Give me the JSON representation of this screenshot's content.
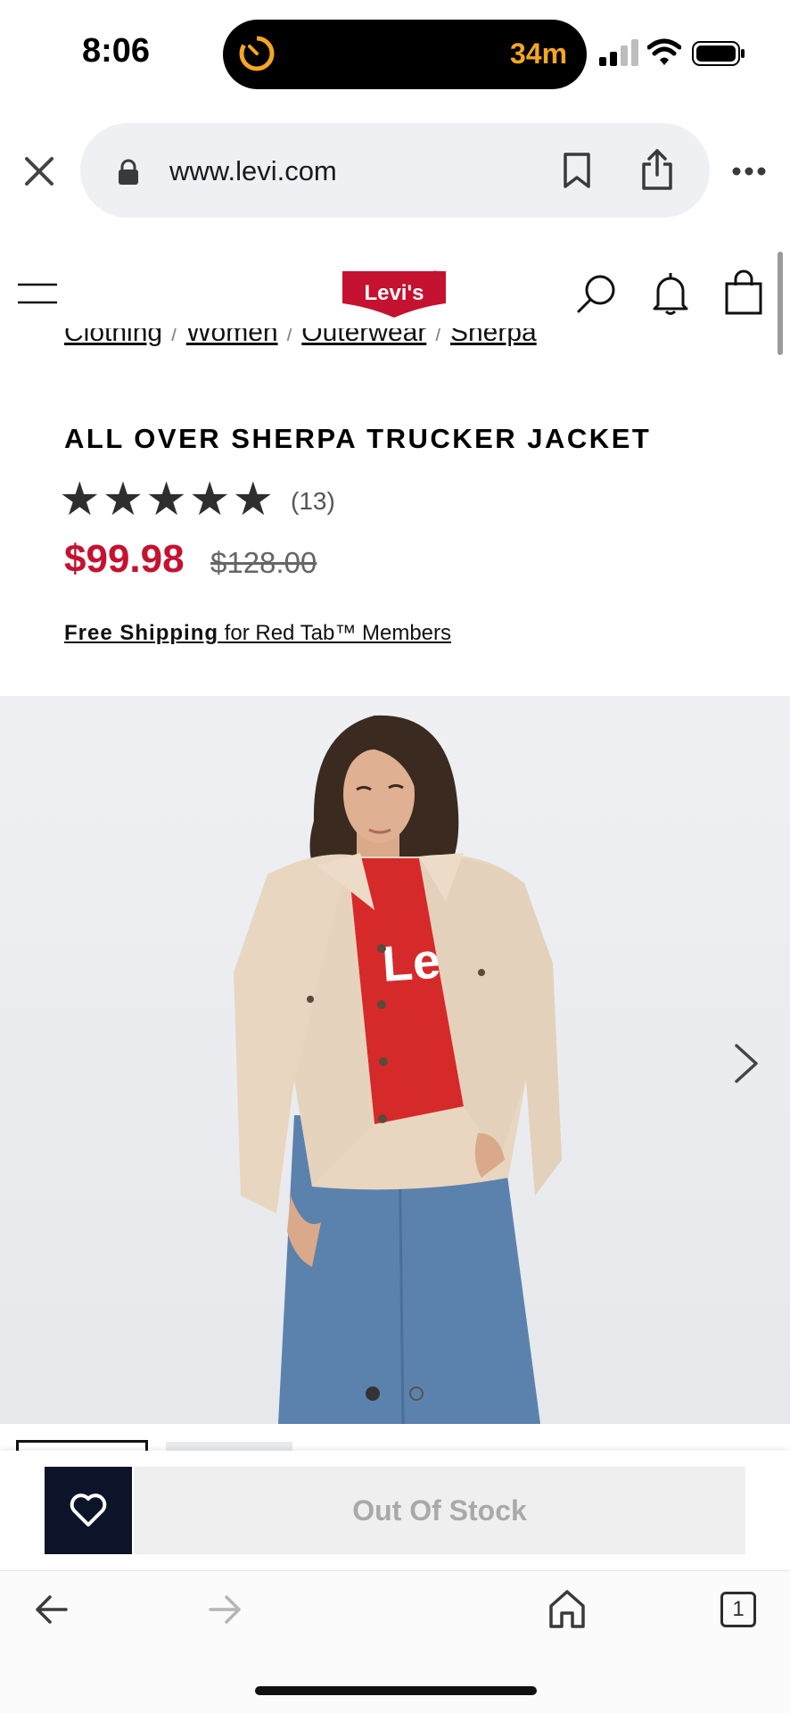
{
  "status_bar": {
    "time": "8:06",
    "timer": "34m",
    "timer_color": "#f5a623"
  },
  "browser": {
    "url": "www.levi.com",
    "icons": [
      "close-icon",
      "lock-icon",
      "bookmark-icon",
      "share-icon",
      "more-icon"
    ]
  },
  "site_header": {
    "logo_text": "Levi's",
    "brand_color": "#c41230",
    "icons": [
      "menu-icon",
      "search-icon",
      "bell-icon",
      "bag-icon"
    ]
  },
  "breadcrumbs": [
    "Clothing",
    "Women",
    "Outerwear",
    "Sherpa"
  ],
  "breadcrumb_separator": "/",
  "product": {
    "title": "ALL OVER SHERPA TRUCKER JACKET",
    "rating_stars": 5,
    "review_count": "(13)",
    "sale_price": "$99.98",
    "original_price": "$128.00",
    "shipping_bold": "Free Shipping",
    "shipping_rest": " for Red Tab™ Members",
    "shirt_text": "Levi's"
  },
  "gallery": {
    "slides": 2,
    "active_slide": 1
  },
  "sticky_bar": {
    "out_of_stock_label": "Out Of Stock"
  },
  "bottom_toolbar": {
    "tab_count": "1"
  }
}
